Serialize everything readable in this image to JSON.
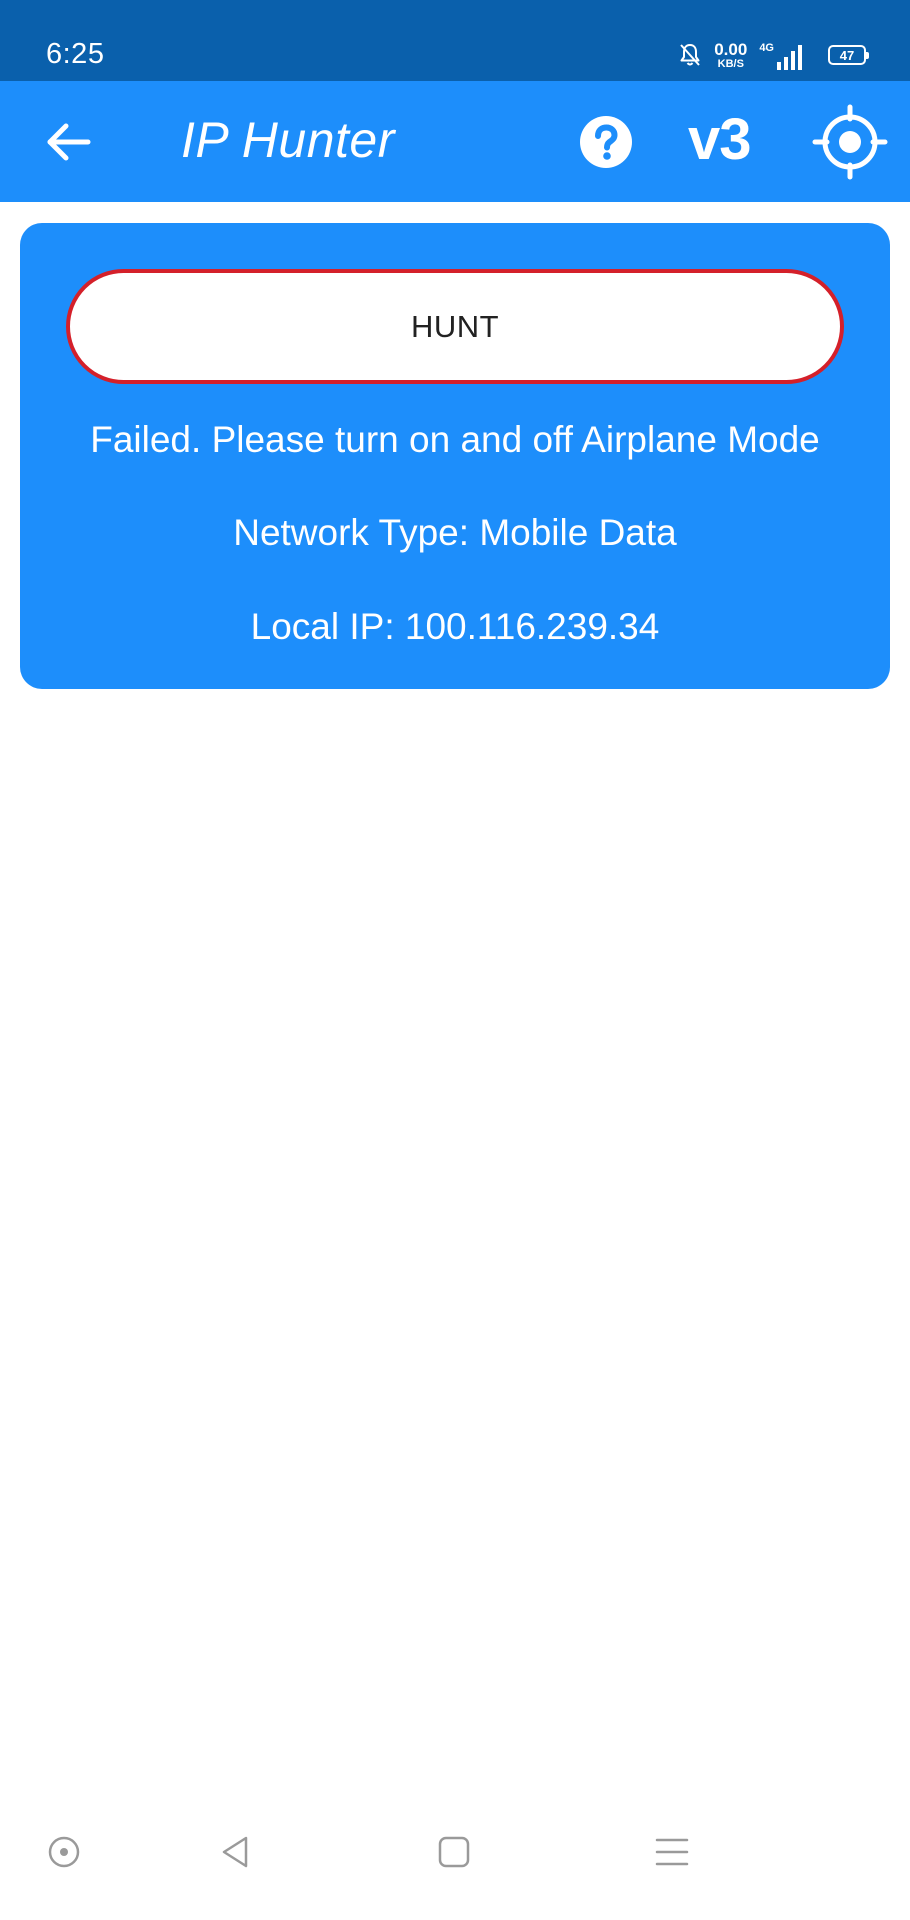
{
  "status_bar": {
    "time": "6:25",
    "net_speed_value": "0.00",
    "net_speed_unit": "KB/S",
    "network_type": "4G",
    "battery_level": "47",
    "icons": [
      "bell-off-icon",
      "signal-icon",
      "battery-icon"
    ]
  },
  "app_bar": {
    "title": "IP Hunter",
    "version_label": "v3",
    "icons": [
      "back-arrow-icon",
      "help-icon",
      "target-icon"
    ]
  },
  "card": {
    "hunt_button_label": "HUNT",
    "status_message": "Failed. Please turn on and off Airplane Mode",
    "network_type": "Network Type: Mobile Data",
    "local_ip": "Local IP: 100.116.239.34"
  },
  "nav_bar": {
    "icons": [
      "assistant-dot-icon",
      "back-triangle-icon",
      "home-square-icon",
      "menu-lines-icon"
    ]
  },
  "colors": {
    "status_bar_bg": "#0a60ac",
    "app_bar_bg": "#1d8efb",
    "card_bg": "#1d8efb",
    "hunt_button_border": "#d4202a",
    "text_on_blue": "#ffffff",
    "nav_icon": "#9a9a9a"
  }
}
